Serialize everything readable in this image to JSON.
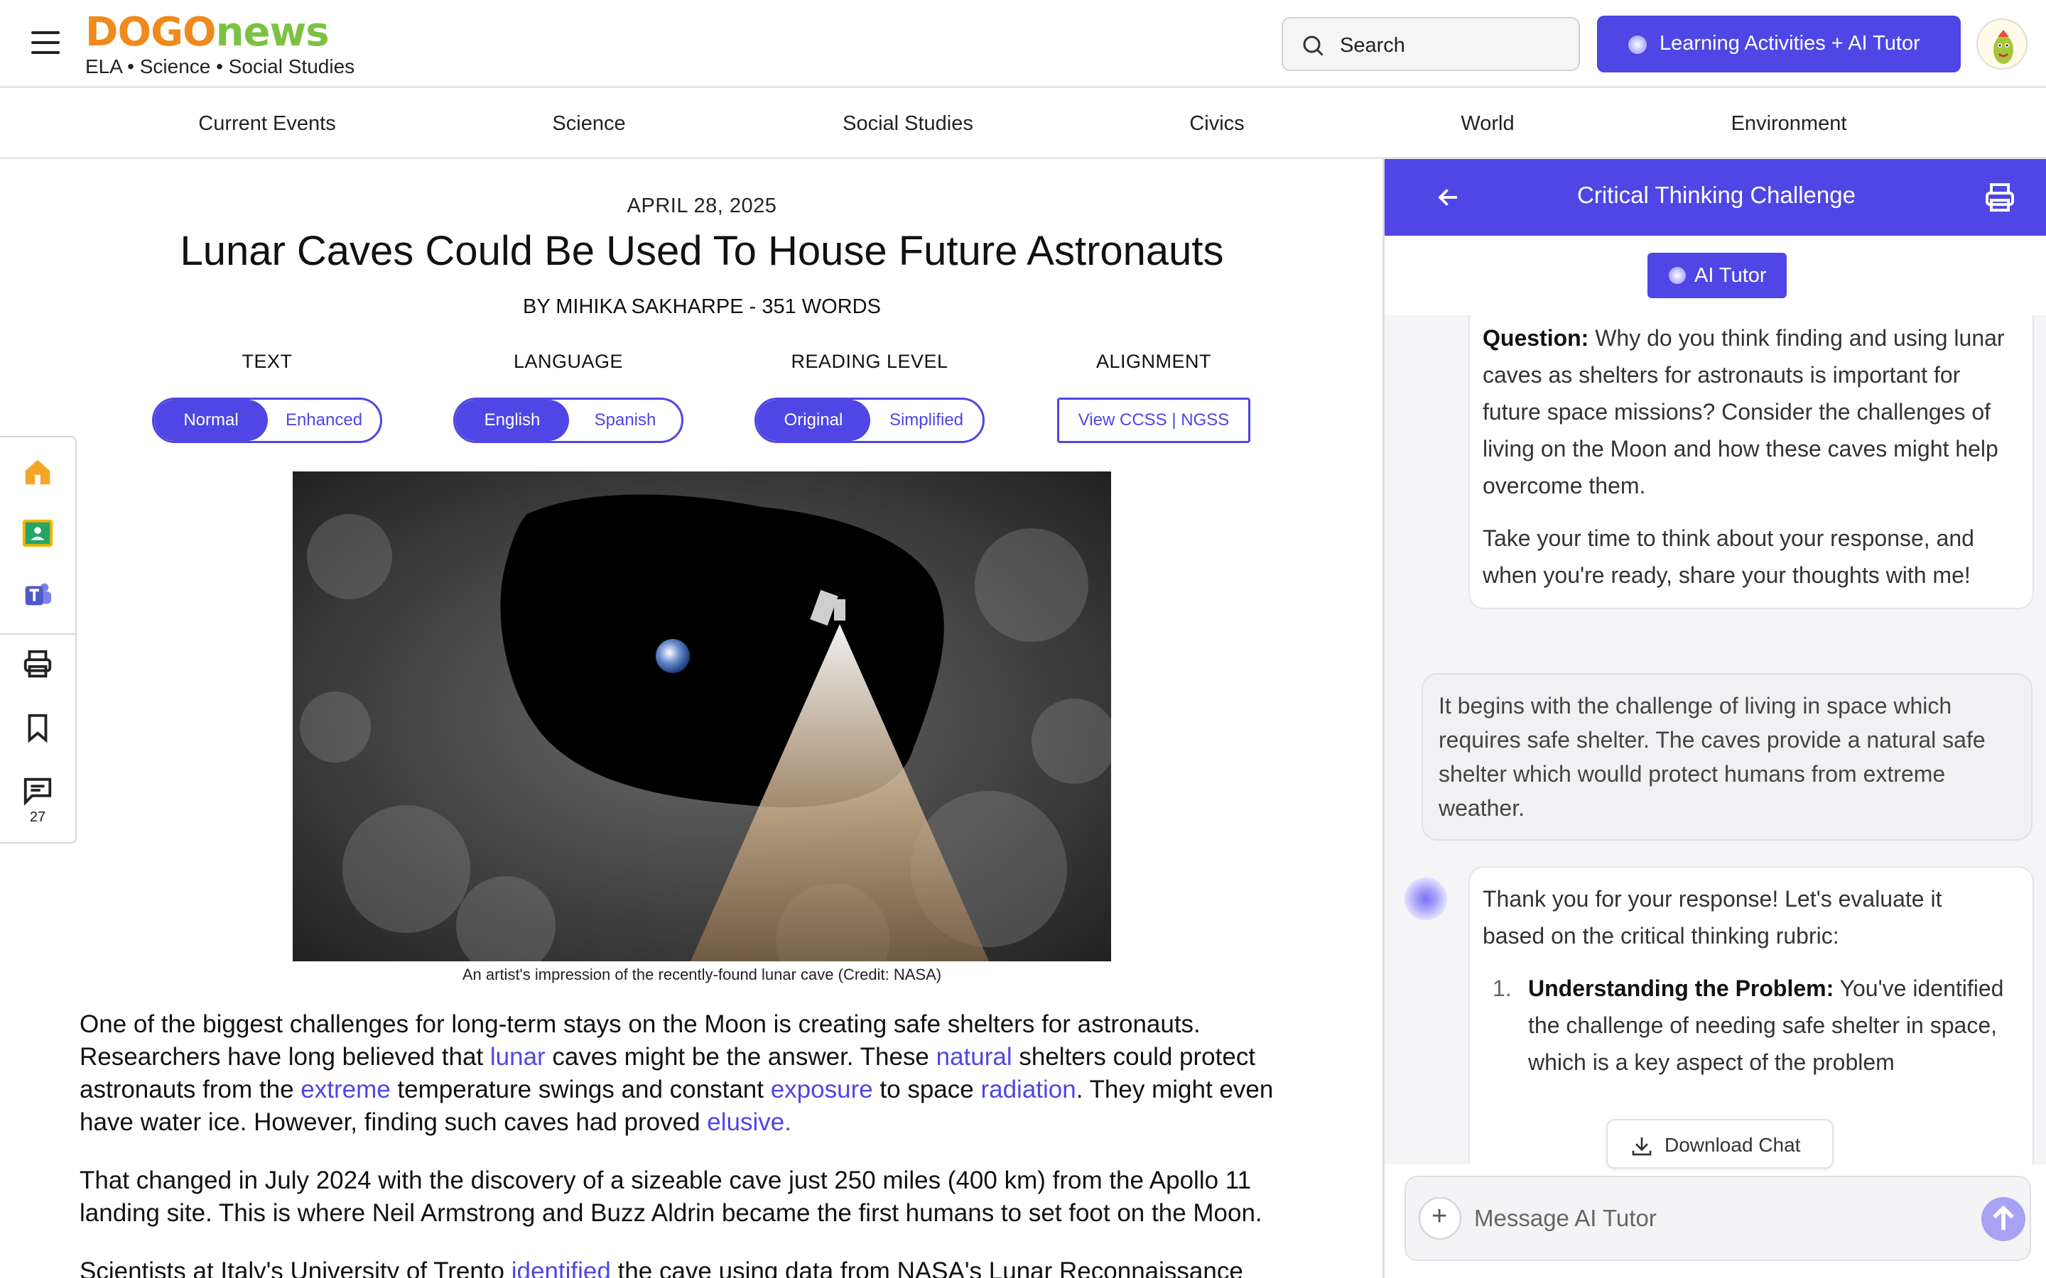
{
  "header": {
    "logo_part1": "DOGO",
    "logo_part2": "news",
    "tagline": "ELA • Science • Social Studies",
    "search_label": "Search",
    "learning_button": "Learning Activities + AI Tutor"
  },
  "nav": {
    "items": [
      "Current Events",
      "Science",
      "Social Studies",
      "Civics",
      "World",
      "Environment"
    ]
  },
  "toolbar": {
    "comment_count": "27"
  },
  "article": {
    "date": "APRIL 28, 2025",
    "title": "Lunar Caves Could Be Used To House Future Astronauts",
    "byline": "BY MIHIKA SAKHARPE - 351 WORDS",
    "controls": {
      "text_label": "TEXT",
      "text_on": "Normal",
      "text_off": "Enhanced",
      "language_label": "LANGUAGE",
      "language_on": "English",
      "language_off": "Spanish",
      "reading_label": "READING LEVEL",
      "reading_on": "Original",
      "reading_off": "Simplified",
      "alignment_label": "ALIGNMENT",
      "alignment_button": "View CCSS | NGSS"
    },
    "caption": "An artist's impression of the recently-found lunar cave (Credit: NASA)",
    "p1": {
      "t1": "One of the biggest challenges for long-term stays on the Moon is creating safe shelters for astronauts. Researchers have long believed that ",
      "l1": "lunar",
      "t2": " caves might be the answer. These ",
      "l2": "natural",
      "t3": " shelters could protect astronauts from the ",
      "l3": "extreme",
      "t4": " temperature swings and constant ",
      "l4": "exposure",
      "t5": " to space ",
      "l5": "radiation",
      "t6": ". They might even have water ice. However, finding such caves had proved ",
      "l6": "elusive."
    },
    "p2": "That changed in July 2024 with the discovery of a sizeable cave just 250 miles (400 km) from the Apollo 11 landing site. This is where Neil Armstrong and Buzz Aldrin became the first humans to set foot on the Moon.",
    "p3": {
      "t1": "Scientists at Italy's University of Trento ",
      "l1": "identified",
      "t2": " the cave using data from NASA's Lunar Reconnaissance"
    }
  },
  "panel": {
    "title": "Critical Thinking Challenge",
    "ai_tutor_label": "AI Tutor",
    "question_label": "Question:",
    "question_text": " Why do you think finding and using lunar caves as shelters for astronauts is important for future space missions? Consider the challenges of living on the Moon and how these caves might help overcome them.",
    "question_followup": "Take your time to think about your response, and when you're ready, share your thoughts with me!",
    "user_reply": "It begins with the challenge of living in space which requires safe shelter. The caves provide a natural safe shelter which woulld protect humans from extreme weather.",
    "ai_reply_intro": "Thank you for your response! Let's evaluate it based on the critical thinking rubric:",
    "rubric_number": "1.",
    "rubric_label": "Understanding the Problem:",
    "rubric_text": " You've identified the challenge of needing safe shelter in space, which is a key aspect of the problem",
    "download_label": "Download Chat",
    "composer_placeholder": "Message AI Tutor"
  }
}
